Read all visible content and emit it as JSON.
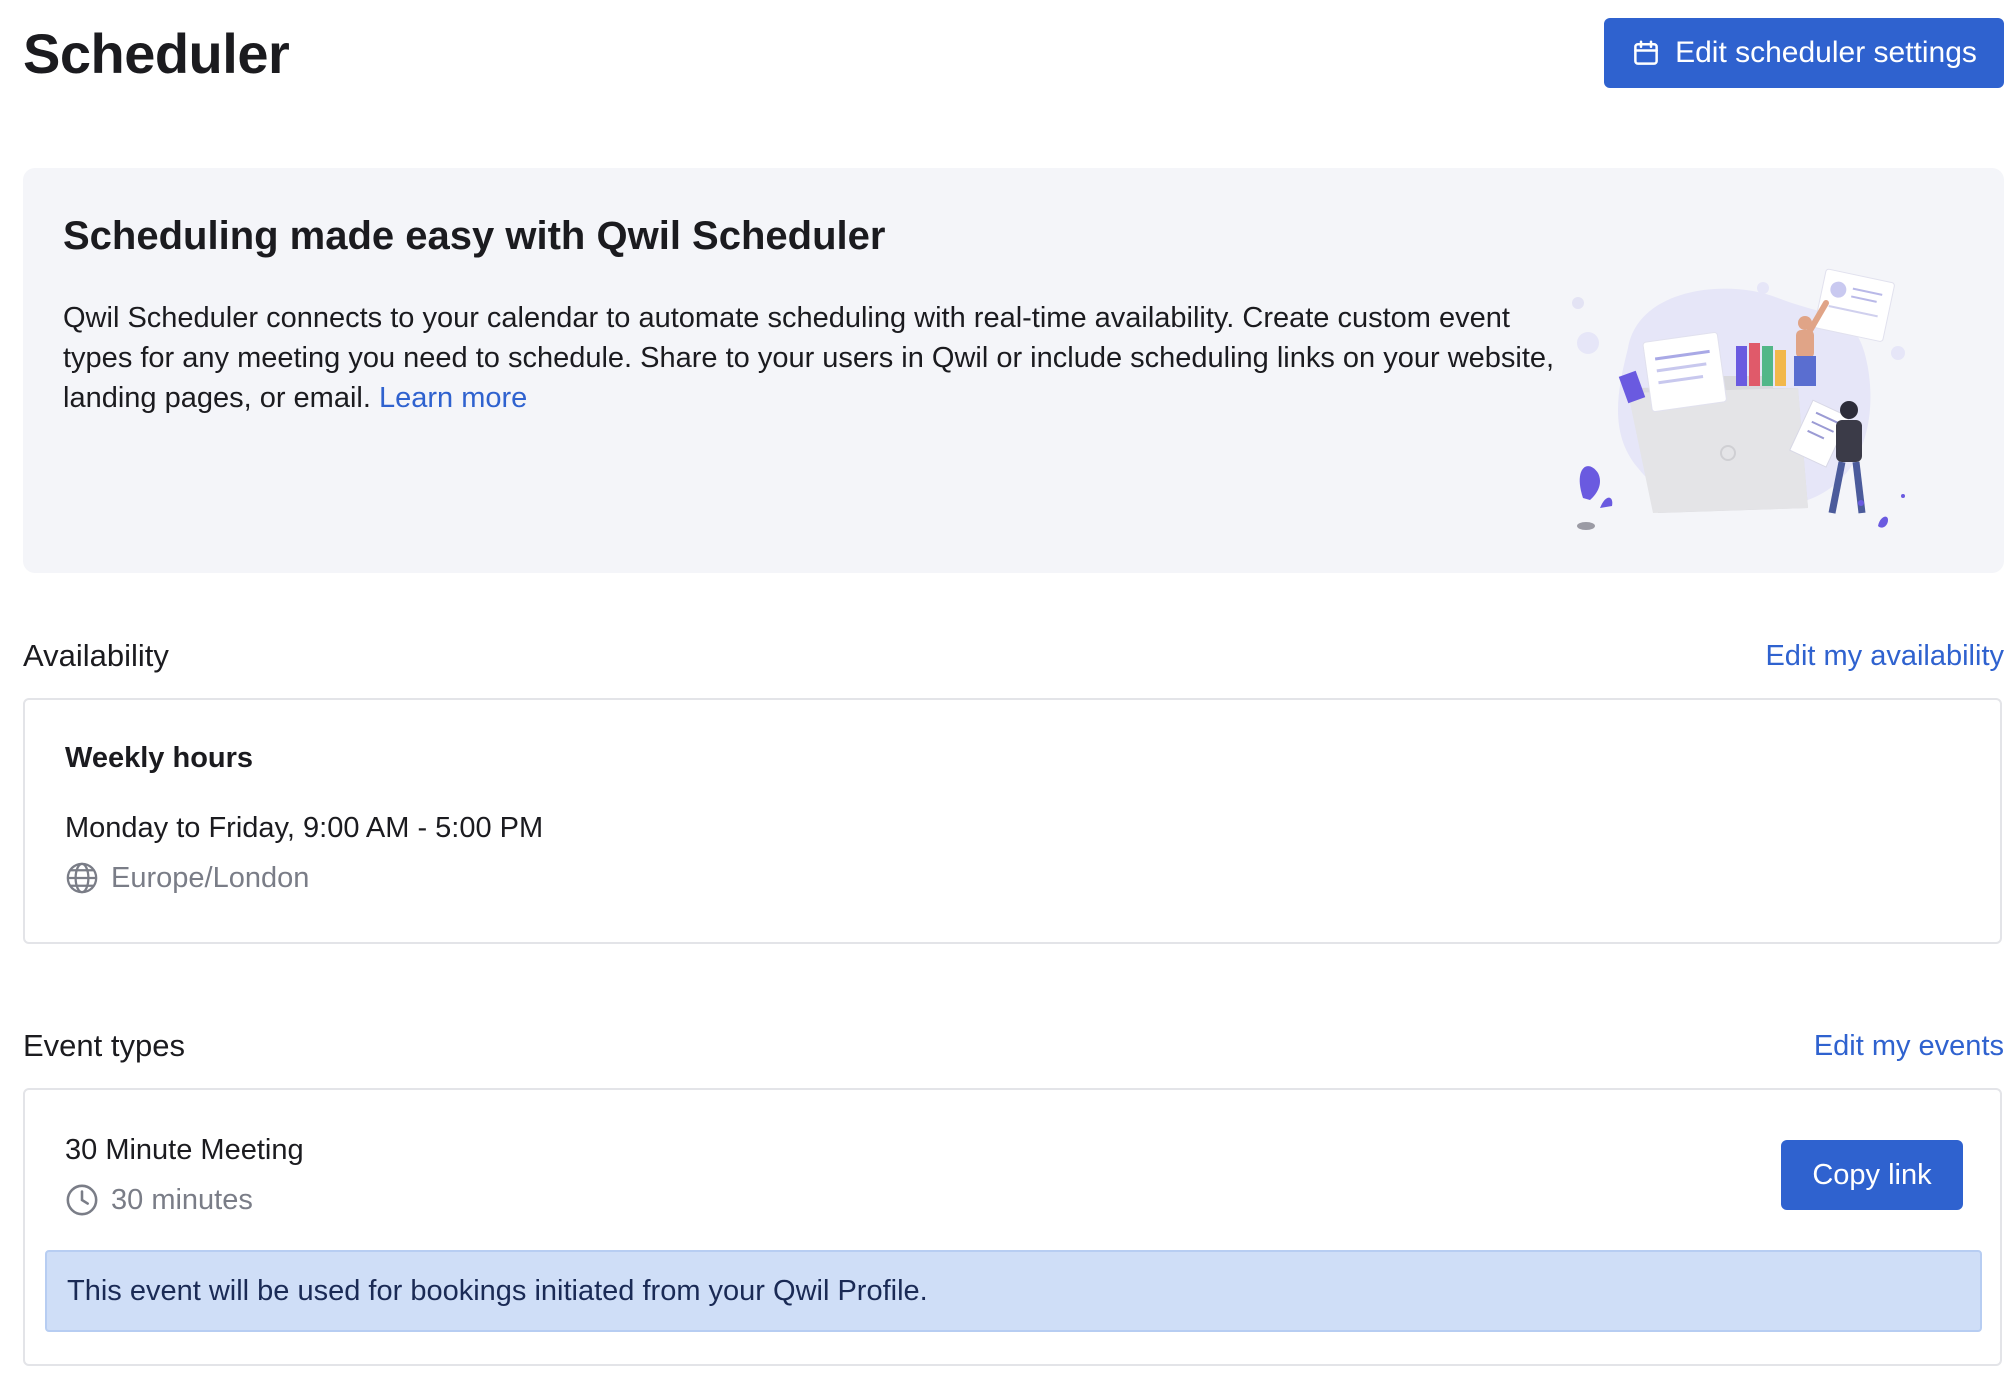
{
  "header": {
    "title": "Scheduler",
    "edit_settings_label": "Edit scheduler settings"
  },
  "banner": {
    "title": "Scheduling made easy with Qwil Scheduler",
    "body": "Qwil Scheduler connects to your calendar to automate scheduling with real-time availability. Create custom event types for any meeting you need to schedule. Share to your users in Qwil or include scheduling links on your website, landing pages, or email.",
    "learn_more": "Learn more"
  },
  "availability": {
    "section_title": "Availability",
    "edit_link": "Edit my availability",
    "weekly_title": "Weekly hours",
    "hours": "Monday to Friday, 9:00 AM - 5:00 PM",
    "timezone": "Europe/London",
    "timezone_icon": "globe-icon"
  },
  "events": {
    "section_title": "Event types",
    "edit_link": "Edit my events",
    "items": [
      {
        "name": "30 Minute Meeting",
        "duration": "30 minutes",
        "duration_icon": "clock-icon",
        "copy_label": "Copy link",
        "notice": "This event will be used for bookings initiated from your Qwil Profile."
      }
    ]
  },
  "colors": {
    "accent": "#2f62cf",
    "banner_bg": "#f4f5f9",
    "notice_bg": "#cfdef7",
    "muted_text": "#7a7d87"
  }
}
